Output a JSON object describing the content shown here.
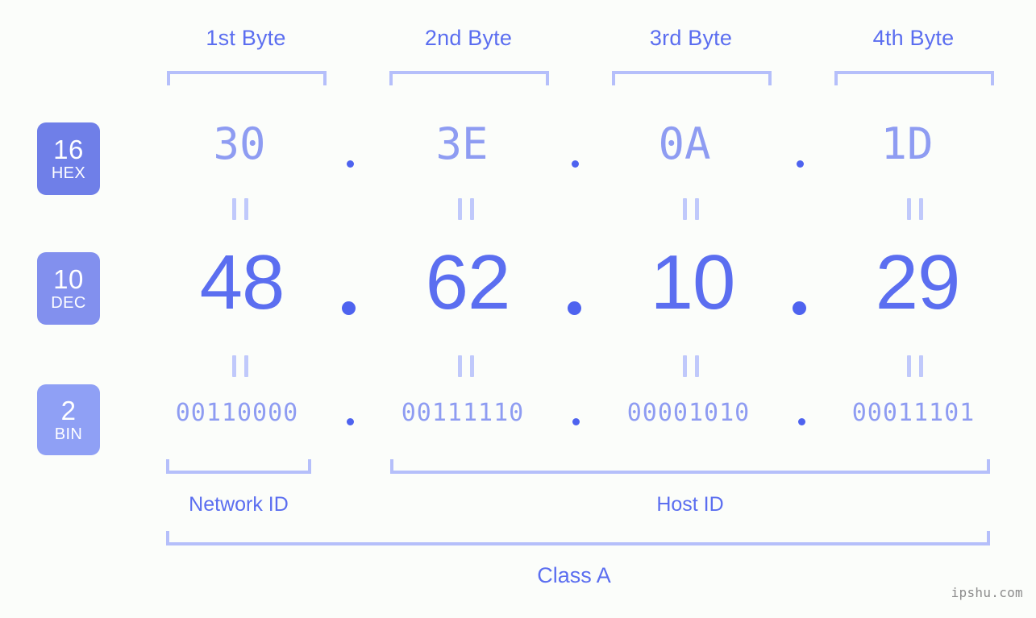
{
  "meta": {
    "watermark": "ipshu.com",
    "accent_color": "#5b6ef0",
    "accent_light_color": "#8e9cf2",
    "bracket_color": "#b5bffa",
    "background_color": "#fbfdfa"
  },
  "byte_headers": [
    {
      "label": "1st Byte"
    },
    {
      "label": "2nd Byte"
    },
    {
      "label": "3rd Byte"
    },
    {
      "label": "4th Byte"
    }
  ],
  "rows": {
    "hex": {
      "badge_number": "16",
      "badge_abbr": "HEX",
      "values": [
        "30",
        "3E",
        "0A",
        "1D"
      ],
      "separator": "."
    },
    "dec": {
      "badge_number": "10",
      "badge_abbr": "DEC",
      "values": [
        "48",
        "62",
        "10",
        "29"
      ],
      "separator": "."
    },
    "bin": {
      "badge_number": "2",
      "badge_abbr": "BIN",
      "values": [
        "00110000",
        "00111110",
        "00001010",
        "00011101"
      ],
      "separator": "."
    }
  },
  "equality_marks": {
    "symbol": "=",
    "count_per_gap": 4
  },
  "sections": [
    {
      "label": "Network ID"
    },
    {
      "label": "Host ID"
    }
  ],
  "class_label": "Class A"
}
